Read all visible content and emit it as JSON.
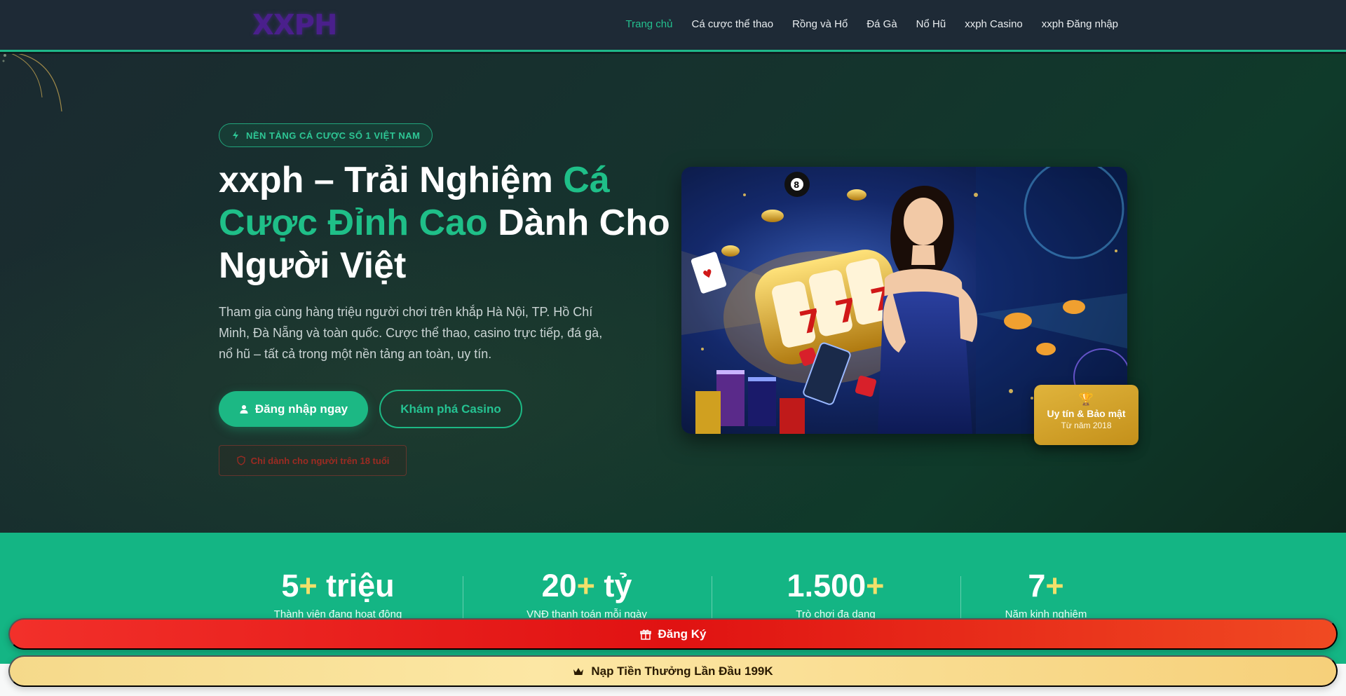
{
  "colors": {
    "accent": "#1fbf88",
    "header_bg": "#1e2a36",
    "gold": "#e0b43c",
    "red_cta": "#e01212"
  },
  "header": {
    "logo": "XXPH",
    "nav": [
      {
        "label": "Trang chủ",
        "active": true
      },
      {
        "label": "Cá cược thể thao"
      },
      {
        "label": "Rồng và Hổ"
      },
      {
        "label": "Đá Gà"
      },
      {
        "label": "Nổ Hũ"
      },
      {
        "label": "xxph Casino"
      },
      {
        "label": "xxph Đăng nhập"
      }
    ]
  },
  "hero": {
    "badge": "NỀN TẢNG CÁ CƯỢC SỐ 1 VIỆT NAM",
    "badge_icon": "bolt-icon",
    "title_part1": "xxph – Trải Nghiệm ",
    "title_highlight": "Cá Cược Đỉnh Cao",
    "title_part2": " Dành Cho Người Việt",
    "description": "Tham gia cùng hàng triệu người chơi trên khắp Hà Nội, TP. Hồ Chí Minh, Đà Nẵng và toàn quốc. Cược thể thao, casino trực tiếp, đá gà, nổ hũ – tất cả trong một nền tảng an toàn, uy tín.",
    "primary_button": "Đăng nhập ngay",
    "primary_icon": "user-icon",
    "secondary_button": "Khám phá Casino",
    "age_notice": "Chỉ dành cho người trên 18 tuổi",
    "trust_badge": {
      "icon": "trophy-icon",
      "title": "Uy tín & Bảo mật",
      "subtitle": "Từ năm 2018"
    }
  },
  "stats": [
    {
      "value": "5",
      "plus": "+",
      "suffix": " triệu",
      "label": "Thành viên đang hoạt động"
    },
    {
      "value": "20",
      "plus": "+",
      "suffix": " tỷ",
      "label": "VNĐ thanh toán mỗi ngày"
    },
    {
      "value": "1.500",
      "plus": "+",
      "suffix": "",
      "label": "Trò chơi đa dạng"
    },
    {
      "value": "7",
      "plus": "+",
      "suffix": "",
      "label": "Năm kinh nghiệm"
    }
  ],
  "cta": {
    "register": "Đăng Ký",
    "register_icon": "gift-icon",
    "deposit": "Nạp Tiền Thưởng Lần Đầu 199K",
    "deposit_icon": "crown-icon"
  }
}
